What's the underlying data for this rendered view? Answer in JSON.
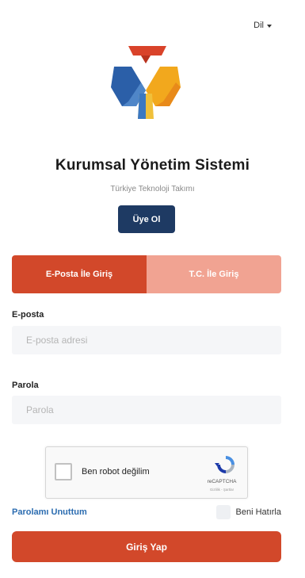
{
  "language": {
    "label": "Dil"
  },
  "brand": {
    "title": "Kurumsal Yönetim Sistemi",
    "subtitle": "Türkiye Teknoloji Takımı"
  },
  "register_button": "Üye Ol",
  "tabs": [
    {
      "label": "E-Posta İle Giriş",
      "active": true
    },
    {
      "label": "T.C. İle Giriş",
      "active": false
    }
  ],
  "email": {
    "label": "E-posta",
    "placeholder": "E-posta adresi"
  },
  "password": {
    "label": "Parola",
    "placeholder": "Parola"
  },
  "captcha": {
    "text": "Ben robot değilim",
    "brand": "reCAPTCHA",
    "terms": "Gizlilik - Şartlar"
  },
  "forgot_link": "Parolamı Unuttum",
  "remember_label": "Beni Hatırla",
  "login_button": "Giriş Yap",
  "colors": {
    "primary": "#d2482a",
    "primary_light": "#f1a392",
    "navy": "#1e3a63",
    "link": "#2b6cb0"
  }
}
